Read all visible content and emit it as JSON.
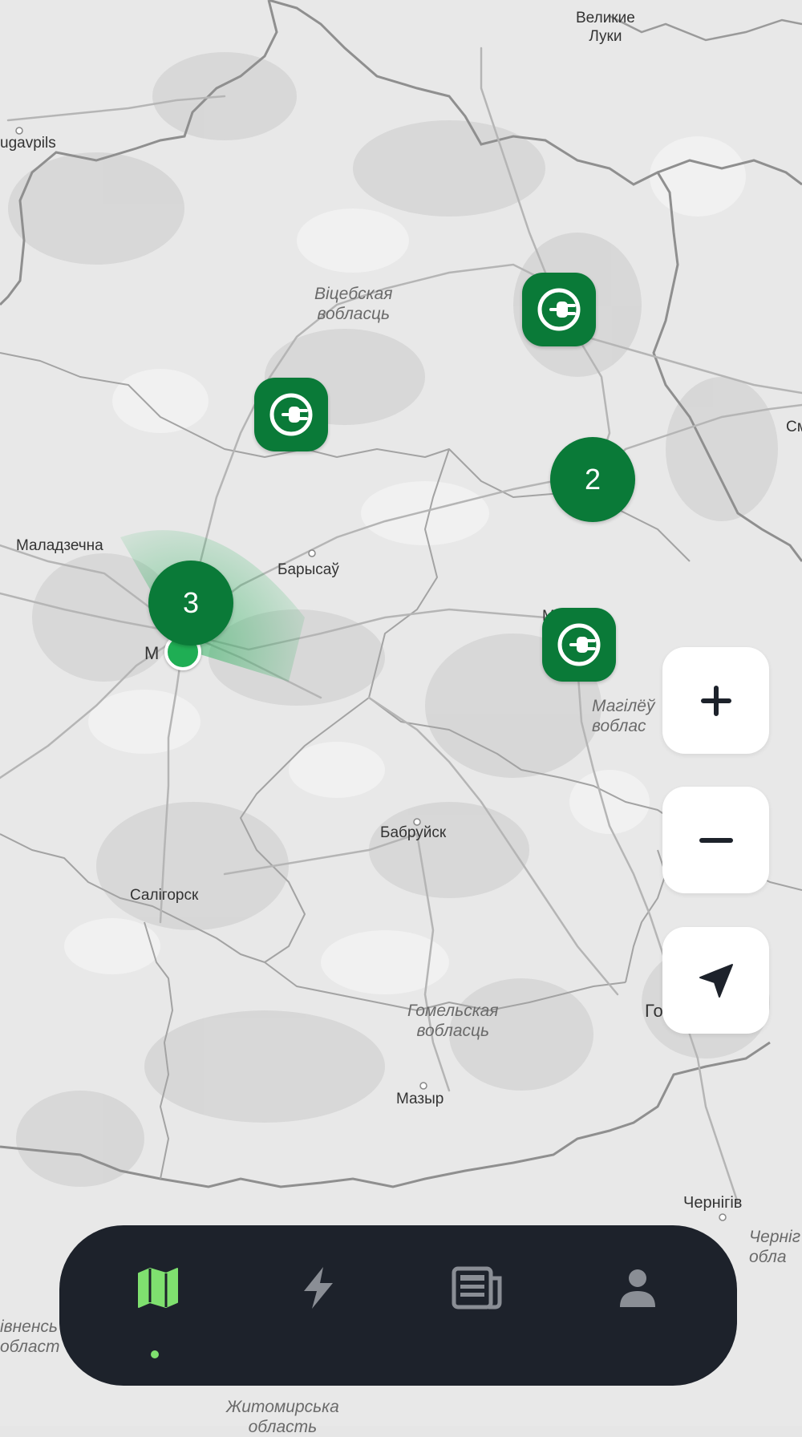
{
  "map": {
    "place_labels": [
      {
        "id": "velikie-luki",
        "text": "Великие\nЛуки"
      },
      {
        "id": "daugavpils",
        "text": "ugavpils"
      },
      {
        "id": "vitebsk-region",
        "text": "Віцебская\nвобласць"
      },
      {
        "id": "smolensk",
        "text": "См"
      },
      {
        "id": "maladzechna",
        "text": "Маладзечна"
      },
      {
        "id": "barysau",
        "text": "Барысаў"
      },
      {
        "id": "minsk",
        "text": "М"
      },
      {
        "id": "mahilyou",
        "text": "Магілёў"
      },
      {
        "id": "mahilyou-region",
        "text": "Магілёў\nвоблас"
      },
      {
        "id": "babruysk",
        "text": "Бабруйск"
      },
      {
        "id": "salihorsk",
        "text": "Салігорск"
      },
      {
        "id": "gomel-region",
        "text": "Гомельская\nвобласць"
      },
      {
        "id": "gomel",
        "text": "Го"
      },
      {
        "id": "mazyr",
        "text": "Мазыр"
      },
      {
        "id": "chernihiv",
        "text": "Чернігів"
      },
      {
        "id": "chernihiv-region",
        "text": "Черніг\nобла"
      },
      {
        "id": "rivne-region",
        "text": "івненсь\nобласт"
      },
      {
        "id": "zhytomyr-region",
        "text": "Житомирська\nобласть"
      }
    ],
    "clusters": [
      {
        "id": "cluster-minsk",
        "count": "3"
      },
      {
        "id": "cluster-east",
        "count": "2"
      }
    ],
    "stations": [
      {
        "id": "station-north",
        "icon": "ev-plug-icon"
      },
      {
        "id": "station-west",
        "icon": "ev-plug-icon"
      },
      {
        "id": "station-mahilyou",
        "icon": "ev-plug-icon"
      }
    ],
    "colors": {
      "marker": "#0a7a38",
      "user": "#1fae54",
      "tab_active": "#7fe06f",
      "tab_inactive": "#8a8e95",
      "tabbar_bg": "#1d222b"
    }
  },
  "controls": {
    "zoom_in_icon": "plus-icon",
    "zoom_out_icon": "minus-icon",
    "locate_icon": "navigation-arrow-icon"
  },
  "tabbar": {
    "tabs": [
      {
        "id": "map",
        "icon": "map-icon",
        "active": true
      },
      {
        "id": "charging",
        "icon": "lightning-icon",
        "active": false
      },
      {
        "id": "news",
        "icon": "newspaper-icon",
        "active": false
      },
      {
        "id": "profile",
        "icon": "person-icon",
        "active": false
      }
    ]
  }
}
